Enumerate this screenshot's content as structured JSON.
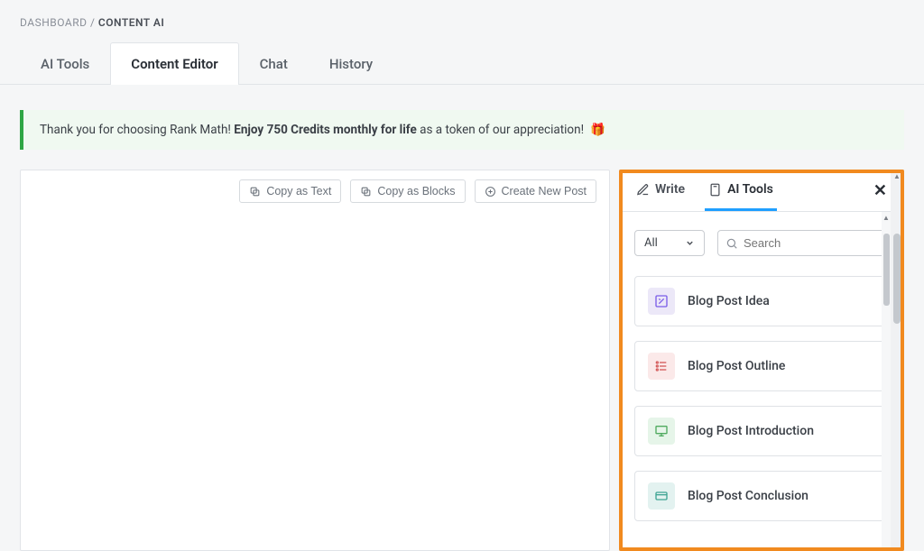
{
  "breadcrumb": {
    "root": "DASHBOARD",
    "sep": "/",
    "current": "CONTENT AI"
  },
  "main_tabs": {
    "ai_tools": "AI Tools",
    "content_editor": "Content Editor",
    "chat": "Chat",
    "history": "History"
  },
  "notice": {
    "pre": "Thank you for choosing Rank Math! ",
    "bold": "Enjoy 750 Credits monthly for life",
    "post": " as a token of our appreciation! "
  },
  "toolbar": {
    "copy_text": "Copy as Text",
    "copy_blocks": "Copy as Blocks",
    "create_post": "Create New Post"
  },
  "side": {
    "tab_write": "Write",
    "tab_ai": "AI Tools",
    "close": "✕",
    "filter_value": "All",
    "search_placeholder": "Search",
    "kbd_hint": "/",
    "tools": [
      {
        "label": "Blog Post Idea"
      },
      {
        "label": "Blog Post Outline"
      },
      {
        "label": "Blog Post Introduction"
      },
      {
        "label": "Blog Post Conclusion"
      }
    ]
  }
}
